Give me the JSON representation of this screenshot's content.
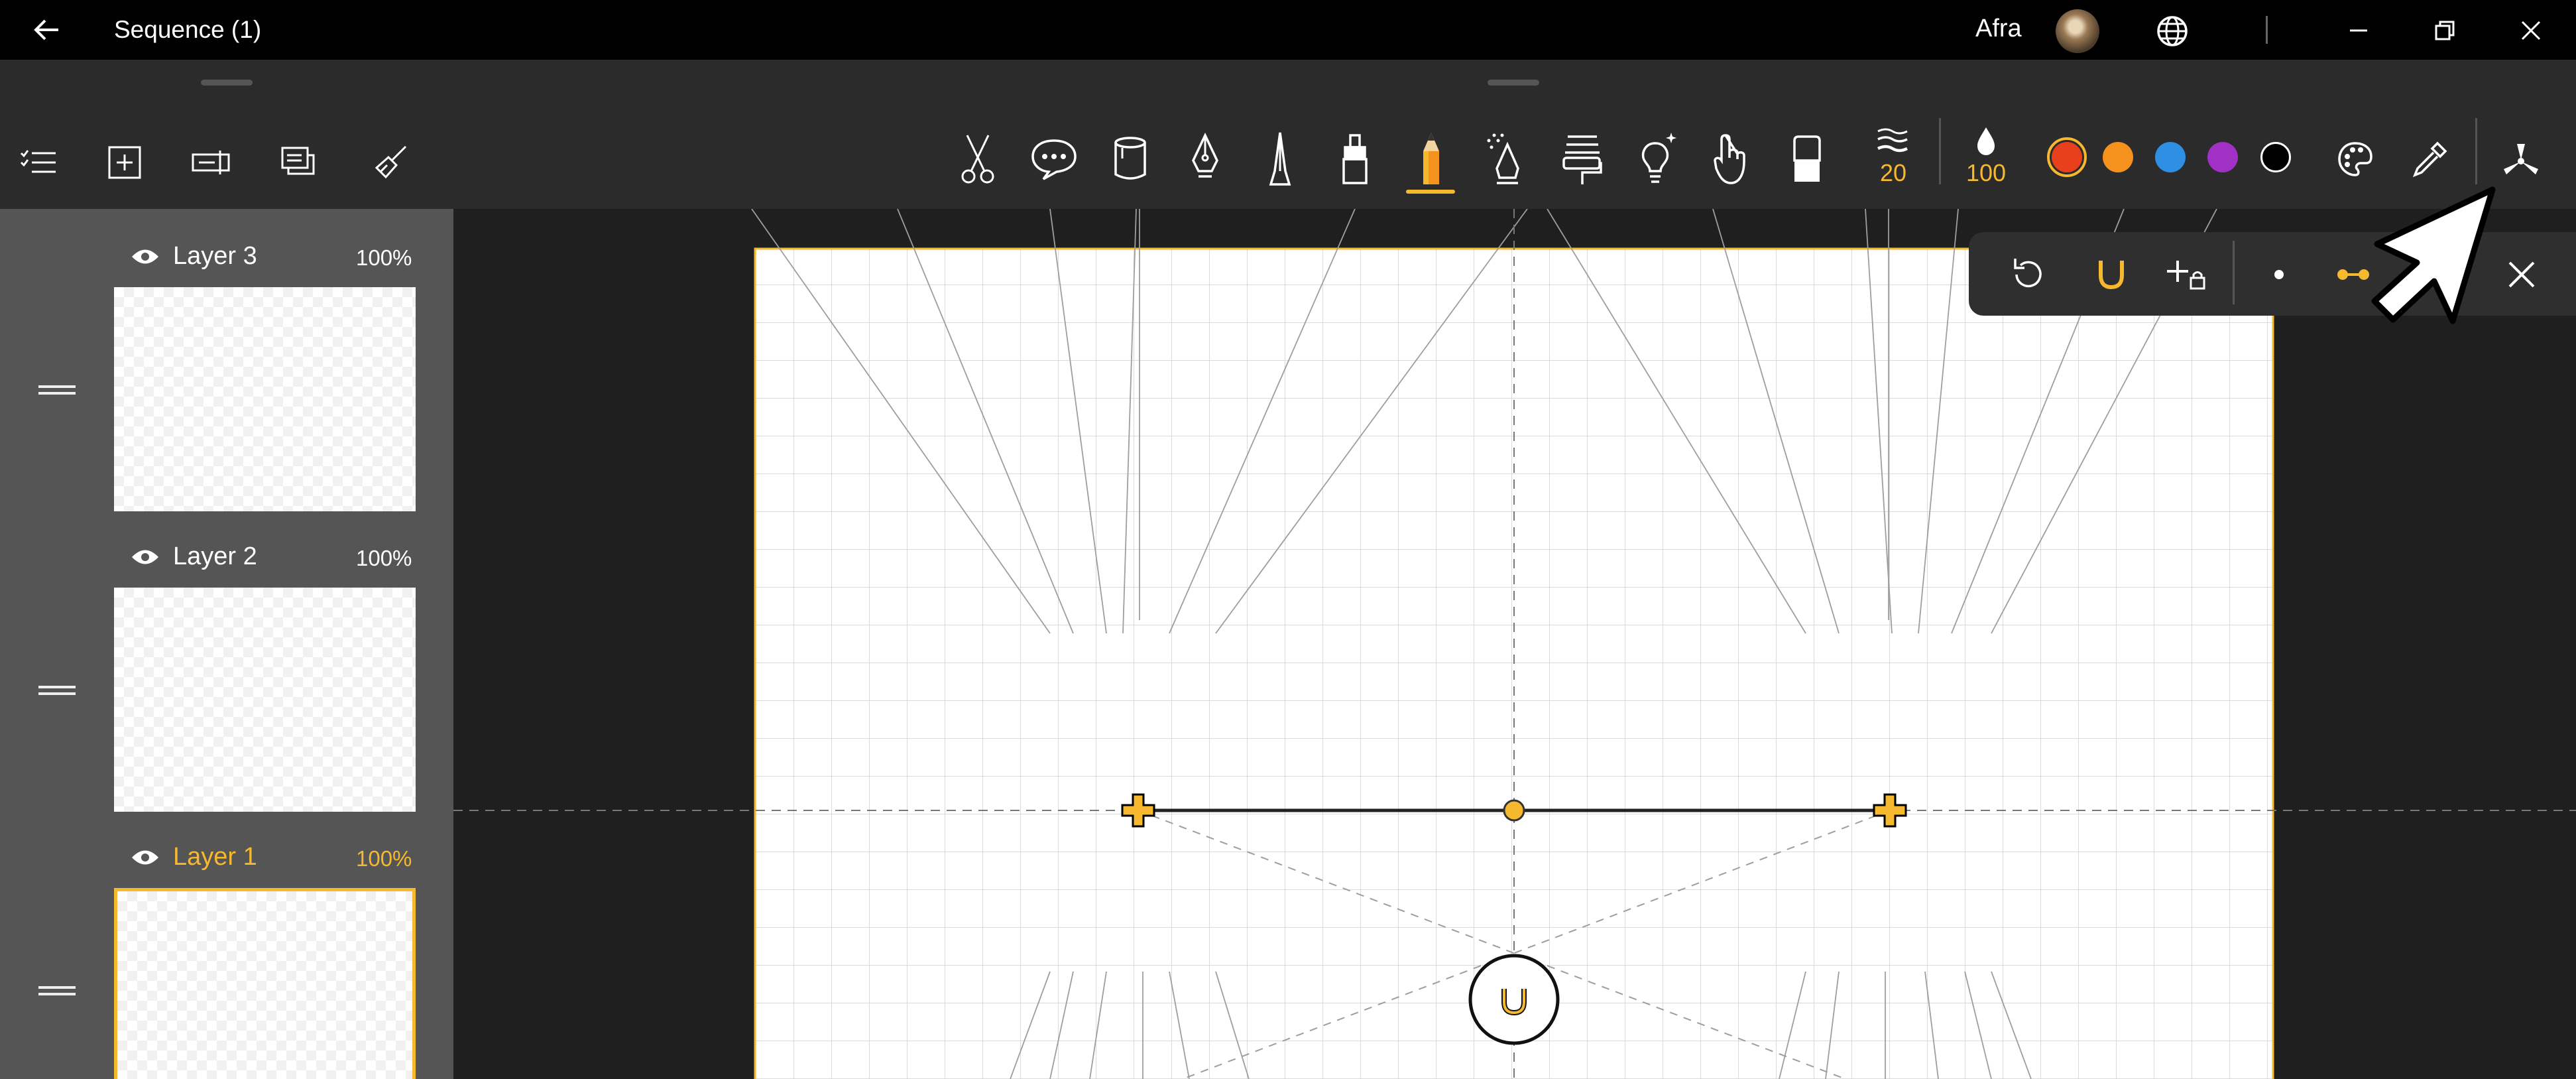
{
  "window": {
    "title": "Sequence (1)",
    "user_name": "Afra"
  },
  "layers": [
    {
      "name": "Layer 3",
      "opacity": "100%",
      "selected": false
    },
    {
      "name": "Layer 2",
      "opacity": "100%",
      "selected": false
    },
    {
      "name": "Layer 1",
      "opacity": "100%",
      "selected": true
    }
  ],
  "layer_toolbar": [
    "checklist-icon",
    "add-layer-icon",
    "layer-properties-icon",
    "duplicate-layer-icon",
    "clear-layer-icon"
  ],
  "tools": [
    "scissors-icon",
    "speech-bubble-icon",
    "paint-bucket-icon",
    "fountain-pen-icon",
    "technical-pen-icon",
    "marker-icon",
    "pencil-icon",
    "airbrush-icon",
    "roller-icon",
    "light-bulb-icon",
    "finger-smudge-icon",
    "eraser-icon"
  ],
  "brush": {
    "size_label": "20",
    "opacity_label": "100"
  },
  "colors": {
    "accent": "#f5b82e",
    "swatches": [
      "#e8401c",
      "#f5921e",
      "#2f8fe3",
      "#a130c4",
      "#000000"
    ],
    "selected_swatch": "#e8401c"
  },
  "perspective_panel": {
    "buttons": [
      "reset-icon",
      "magnet-icon",
      "add-lock-icon",
      "single-point-icon",
      "two-point-icon",
      "close-icon"
    ]
  }
}
